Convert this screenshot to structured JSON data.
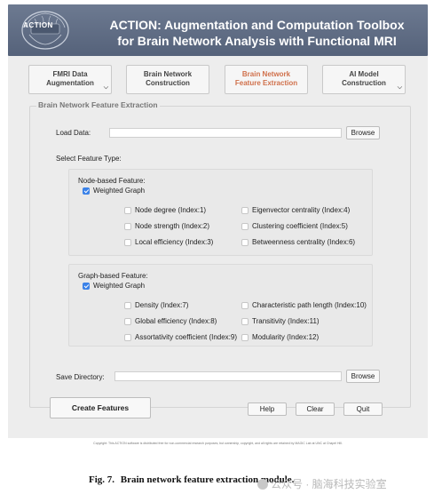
{
  "header": {
    "logo_text": "ACTION",
    "title_line1": "ACTION: Augmentation and Computation Toolbox",
    "title_line2": "for Brain Network Analysis with Functional MRI"
  },
  "tabs": [
    {
      "line1": "FMRI Data",
      "line2": "Augmentation",
      "has_dropdown": true
    },
    {
      "line1": "Brain Network",
      "line2": "Construction",
      "has_dropdown": false
    },
    {
      "line1": "Brain Network",
      "line2": "Feature Extraction",
      "has_dropdown": false,
      "active": true
    },
    {
      "line1": "AI Model",
      "line2": "Construction",
      "has_dropdown": true
    }
  ],
  "panel": {
    "title": "Brain Network Feature Extraction",
    "load_data_label": "Load Data:",
    "load_data_value": "",
    "browse_label": "Browse",
    "select_type_label": "Select Feature Type:",
    "node_group": {
      "title": "Node-based Feature:",
      "weighted_label": "Weighted Graph",
      "weighted_checked": true,
      "options_left": [
        {
          "label": "Node degree (Index:1)",
          "checked": false
        },
        {
          "label": "Node strength (Index:2)",
          "checked": false
        },
        {
          "label": "Local efficiency (Index:3)",
          "checked": false
        }
      ],
      "options_right": [
        {
          "label": "Eigenvector centrality (Index:4)",
          "checked": false
        },
        {
          "label": "Clustering coefficient (Index:5)",
          "checked": false
        },
        {
          "label": "Betweenness centrality (Index:6)",
          "checked": false
        }
      ]
    },
    "graph_group": {
      "title": "Graph-based Feature:",
      "weighted_label": "Weighted Graph",
      "weighted_checked": true,
      "options_left": [
        {
          "label": "Density (Index:7)",
          "checked": false
        },
        {
          "label": "Global efficiency (Index:8)",
          "checked": false
        },
        {
          "label": "Assortativity coefficient (Index:9)",
          "checked": false
        }
      ],
      "options_right": [
        {
          "label": "Characteristic path length (Index:10)",
          "checked": false
        },
        {
          "label": "Transitivity (Index:11)",
          "checked": false
        },
        {
          "label": "Modularity (Index:12)",
          "checked": false
        }
      ]
    },
    "save_dir_label": "Save Directory:",
    "save_dir_value": "",
    "save_browse_label": "Browse"
  },
  "buttons": {
    "create": "Create Features",
    "help": "Help",
    "clear": "Clear",
    "quit": "Quit"
  },
  "copyright": "Copyright: This ACTION software is distributed free for non-commercial research purposes, but ownership, copyright, and all rights are retained by MAGIC Lab at UNC at Chapel Hill.",
  "caption": {
    "number": "Fig. 7.",
    "text": "Brain network feature extraction module."
  },
  "watermark": "公众号 · 脑海科技实验室",
  "colors": {
    "header_bg": "#5f6c84",
    "active_tab_text": "#d0704b",
    "checkbox_blue": "#3b82e8"
  }
}
